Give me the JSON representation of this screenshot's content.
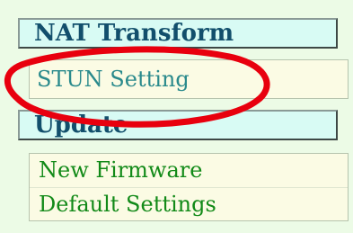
{
  "menu": {
    "sections": [
      {
        "label": "NAT Transform"
      },
      {
        "label": "Update"
      }
    ],
    "nat_items": [
      {
        "label": "STUN Setting"
      }
    ],
    "update_items": [
      {
        "label": "New Firmware"
      },
      {
        "label": "Default Settings"
      }
    ]
  },
  "annotation": {
    "shape": "ellipse",
    "color": "#e8000e",
    "target": "STUN Setting"
  }
}
